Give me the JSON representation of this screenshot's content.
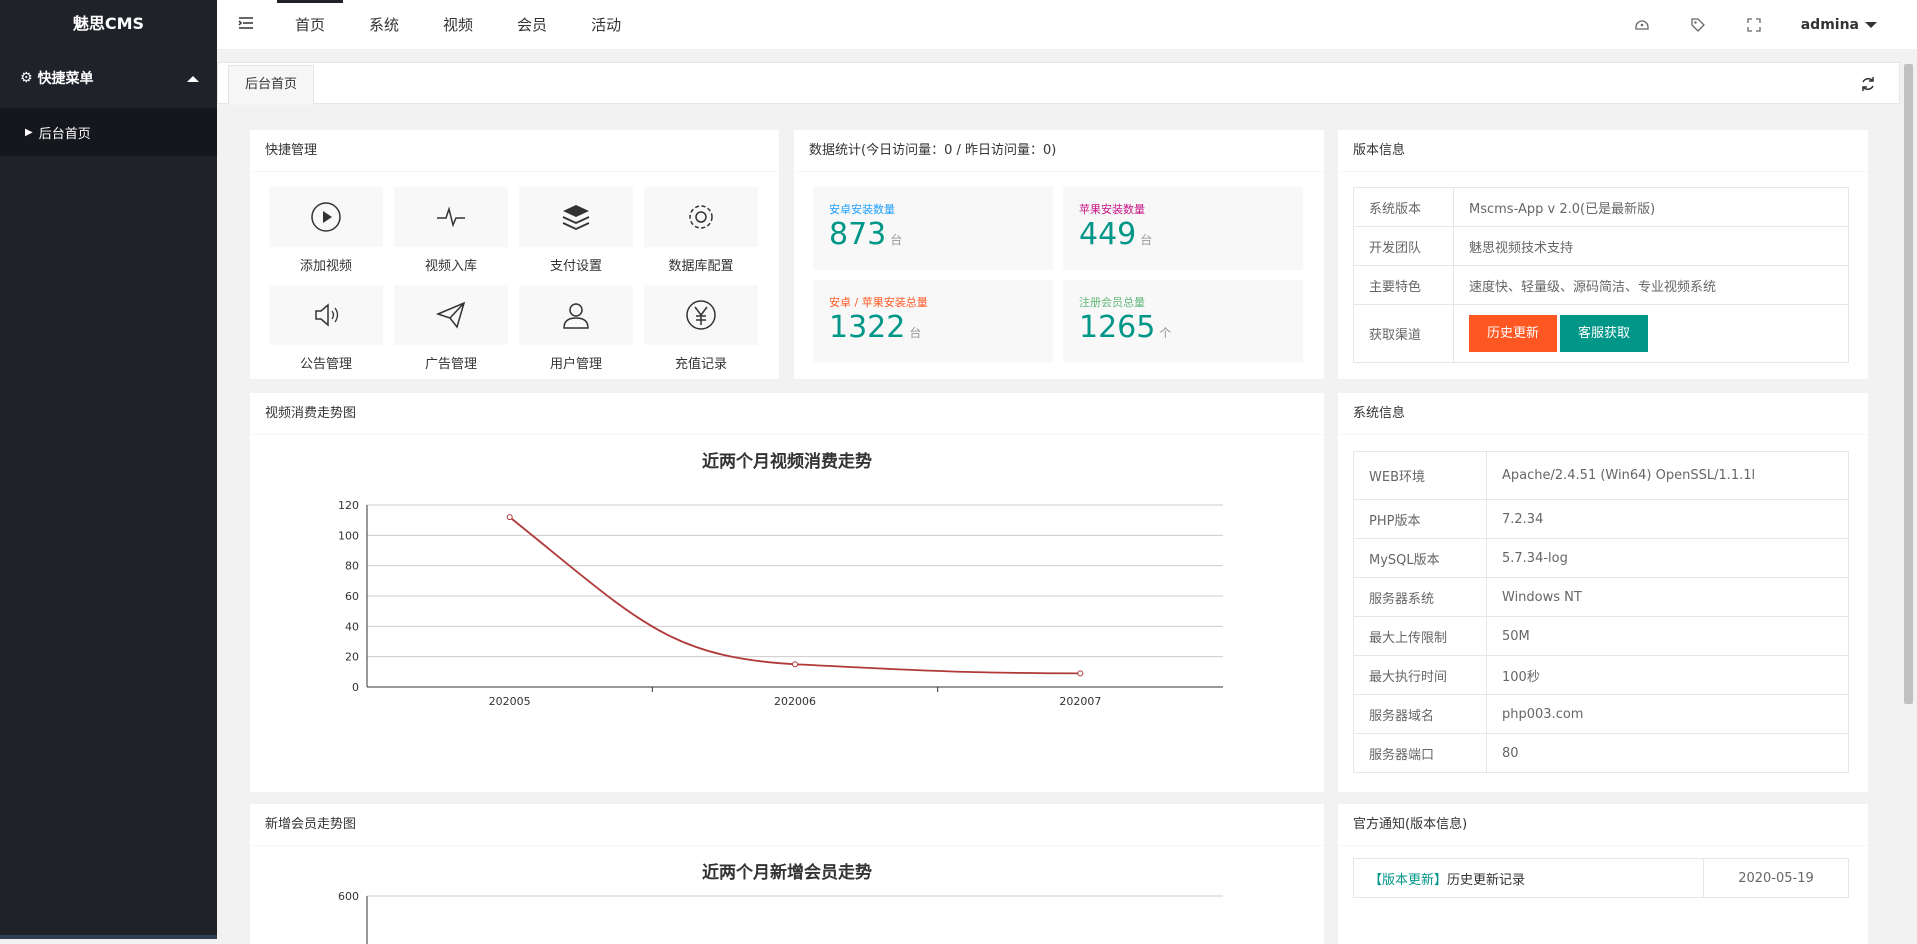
{
  "sidebar": {
    "logo": "魅思CMS",
    "group_label": "快捷菜单",
    "items": [
      {
        "label": "后台首页"
      }
    ]
  },
  "header": {
    "nav": [
      {
        "label": "首页"
      },
      {
        "label": "系统"
      },
      {
        "label": "视频"
      },
      {
        "label": "会员"
      },
      {
        "label": "活动"
      }
    ],
    "user": "admina"
  },
  "tabs": [
    {
      "label": "后台首页"
    }
  ],
  "quick": {
    "title": "快捷管理",
    "items": [
      {
        "label": "添加视频",
        "icon": "play-circle-icon"
      },
      {
        "label": "视频入库",
        "icon": "pulse-icon"
      },
      {
        "label": "支付设置",
        "icon": "layers-icon"
      },
      {
        "label": "数据库配置",
        "icon": "gear-icon"
      },
      {
        "label": "公告管理",
        "icon": "speaker-icon"
      },
      {
        "label": "广告管理",
        "icon": "paper-plane-icon"
      },
      {
        "label": "用户管理",
        "icon": "user-icon"
      },
      {
        "label": "充值记录",
        "icon": "yen-icon"
      }
    ]
  },
  "stats": {
    "title": "数据统计(今日访问量：0 / 昨日访问量：0)",
    "items": [
      {
        "label": "安卓安装数量",
        "value": "873",
        "unit": "台",
        "color": "#1e9fff"
      },
      {
        "label": "苹果安装数量",
        "value": "449",
        "unit": "台",
        "color": "#c71585"
      },
      {
        "label": "安卓 / 苹果安装总量",
        "value": "1322",
        "unit": "台",
        "color": "#ff5722"
      },
      {
        "label": "注册会员总量",
        "value": "1265",
        "unit": "个",
        "color": "#5fb878"
      }
    ]
  },
  "version": {
    "title": "版本信息",
    "rows": [
      {
        "k": "系统版本",
        "v": "Mscms-App v 2.0(已是最新版)"
      },
      {
        "k": "开发团队",
        "v": "魅思视频技术支持"
      },
      {
        "k": "主要特色",
        "v": "速度快、轻量级、源码简洁、专业视频系统"
      }
    ],
    "channel_label": "获取渠道",
    "btn_history": "历史更新",
    "btn_service": "客服获取"
  },
  "sysinfo": {
    "title": "系统信息",
    "rows": [
      {
        "k": "WEB环境",
        "v": "Apache/2.4.51 (Win64) OpenSSL/1.1.1l"
      },
      {
        "k": "PHP版本",
        "v": "7.2.34"
      },
      {
        "k": "MySQL版本",
        "v": "5.7.34-log"
      },
      {
        "k": "服务器系统",
        "v": "Windows NT"
      },
      {
        "k": "最大上传限制",
        "v": "50M"
      },
      {
        "k": "最大执行时间",
        "v": "100秒"
      },
      {
        "k": "服务器域名",
        "v": "php003.com"
      },
      {
        "k": "服务器端口",
        "v": "80"
      }
    ]
  },
  "notice": {
    "title": "官方通知(版本信息)",
    "tag": "【版本更新】",
    "text": "历史更新记录",
    "date": "2020-05-19"
  },
  "chart1_card_title": "视频消费走势图",
  "chart2_card_title": "新增会员走势图",
  "chart_data": [
    {
      "type": "line",
      "title": "近两个月视频消费走势",
      "categories": [
        "202005",
        "202006",
        "202007"
      ],
      "series": [
        {
          "values": [
            112,
            15,
            9
          ]
        }
      ],
      "ylim": [
        0,
        120
      ],
      "yticks": [
        0,
        20,
        40,
        60,
        80,
        100,
        120
      ],
      "color": "#b03a3a",
      "grid": true
    },
    {
      "type": "line",
      "title": "近两个月新增会员走势",
      "yticks": [
        600
      ],
      "grid": true
    }
  ]
}
